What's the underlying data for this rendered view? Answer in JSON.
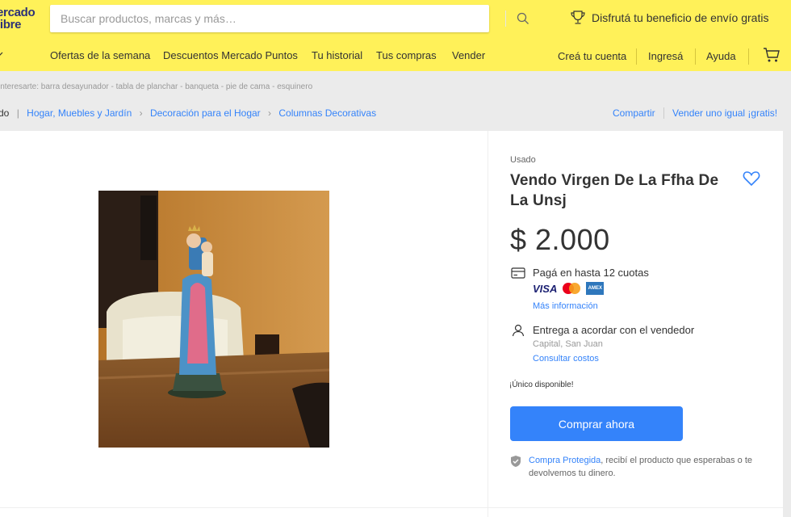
{
  "header": {
    "logo_line1": "ercado",
    "logo_line2": "libre",
    "search_placeholder": "Buscar productos, marcas y más…",
    "promo": "Disfrutá tu beneficio de envío gratis",
    "nav": [
      "Ofertas de la semana",
      "Descuentos Mercado Puntos",
      "Tu historial",
      "Tus compras",
      "Vender"
    ],
    "user_nav": [
      "Creá tu cuenta",
      "Ingresá",
      "Ayuda"
    ]
  },
  "related": "interesarte: barra desayunador - tabla de planchar - banqueta - pie de cama - esquinero",
  "breadcrumb": {
    "first": "do",
    "items": [
      "Hogar, Muebles y Jardín",
      "Decoración para el Hogar",
      "Columnas Decorativas"
    ],
    "share": "Compartir",
    "sell_same": "Vender uno igual ¡gratis!"
  },
  "product": {
    "condition": "Usado",
    "title": "Vendo Virgen De La Ffha De La Unsj",
    "price": "$ 2.000",
    "installments": "Pagá en hasta 12 cuotas",
    "card_visa": "VISA",
    "card_amex": "AMEX",
    "more_info": "Más información",
    "delivery": "Entrega a acordar con el vendedor",
    "location": "Capital, San Juan",
    "shipping_costs": "Consultar costos",
    "stock": "¡Único disponible!",
    "buy_label": "Comprar ahora",
    "protect_link": "Compra Protegida",
    "protect_text": ", recibí el producto que esperabas o te devolvemos tu dinero."
  },
  "colors": {
    "header_bg": "#fff159",
    "accent": "#3483fa",
    "page_bg": "#ebebeb"
  }
}
